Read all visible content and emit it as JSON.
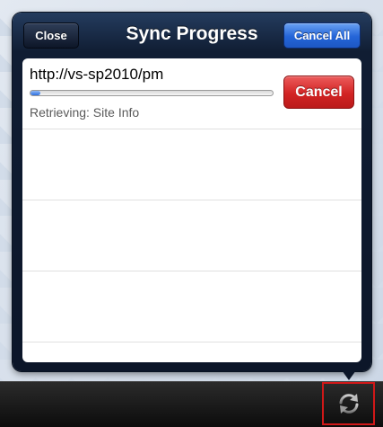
{
  "popover": {
    "title": "Sync Progress",
    "close_label": "Close",
    "cancel_all_label": "Cancel All"
  },
  "sync_items": [
    {
      "url": "http://vs-sp2010/pm",
      "status": "Retrieving: Site Info",
      "progress": 0.04,
      "cancel_label": "Cancel"
    }
  ],
  "toolbar": {
    "sync_icon": "sync-arrows-icon"
  },
  "colors": {
    "nav_background": "#101d33",
    "cancel_all_blue": "#2465d8",
    "cancel_red": "#d22424",
    "progress_blue": "#2c6fe0",
    "highlight_box": "#d01818"
  }
}
